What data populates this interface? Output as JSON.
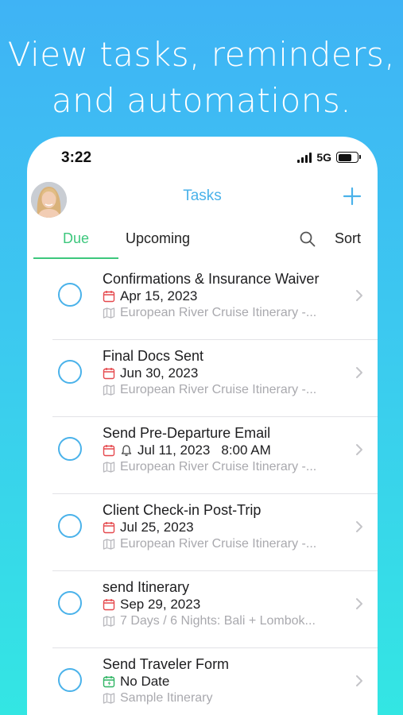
{
  "headline": {
    "line1": "View tasks, reminders,",
    "line2": "and automations."
  },
  "status_bar": {
    "time": "3:22",
    "network": "5G"
  },
  "nav": {
    "title": "Tasks"
  },
  "tabs": {
    "due": "Due",
    "upcoming": "Upcoming",
    "sort": "Sort"
  },
  "tasks": [
    {
      "title": "Confirmations & Insurance Waiver",
      "date": "Apr 15, 2023",
      "time": "",
      "itinerary": "European River Cruise Itinerary -...",
      "date_icon": "calendar-icon"
    },
    {
      "title": "Final Docs Sent",
      "date": "Jun 30, 2023",
      "time": "",
      "itinerary": "European River Cruise Itinerary -...",
      "date_icon": "calendar-icon"
    },
    {
      "title": "Send Pre-Departure Email",
      "date": "Jul 11, 2023",
      "time": "8:00 AM",
      "itinerary": "European River Cruise Itinerary -...",
      "date_icon": "calendar-icon"
    },
    {
      "title": "Client Check-in Post-Trip",
      "date": "Jul 25, 2023",
      "time": "",
      "itinerary": "European River Cruise Itinerary -...",
      "date_icon": "calendar-icon"
    },
    {
      "title": "send Itinerary",
      "date": "Sep 29, 2023",
      "time": "",
      "itinerary": "7 Days / 6 Nights: Bali + Lombok...",
      "date_icon": "calendar-icon"
    },
    {
      "title": "Send Traveler Form",
      "date": "No Date",
      "time": "",
      "itinerary": "Sample Itinerary",
      "date_icon": "calendar-bolt-icon"
    }
  ],
  "colors": {
    "accent_blue": "#4ab2ea",
    "tab_green": "#3dc77d",
    "calendar_red": "#e5484d",
    "automation_green": "#2fb463",
    "muted_text": "#a9a9ae"
  }
}
